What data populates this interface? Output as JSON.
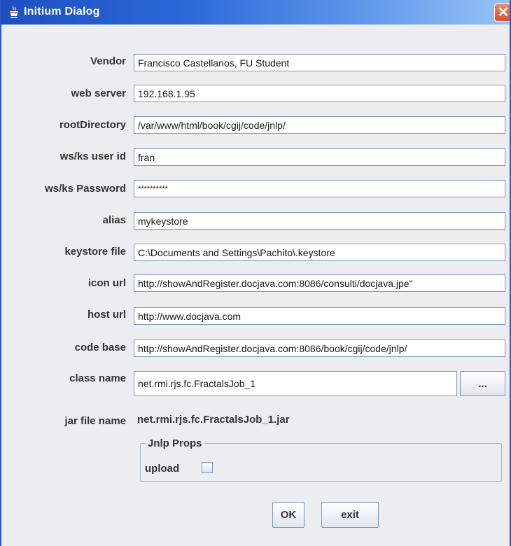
{
  "window": {
    "title": "Initium Dialog",
    "close_symbol": "✕"
  },
  "fields": [
    {
      "label": "Vendor",
      "value": "Francisco Castellanos, FU Student"
    },
    {
      "label": "web server",
      "value": "192.168.1.95"
    },
    {
      "label": "rootDirectory",
      "value": "/var/www/html/book/cgij/code/jnlp/"
    },
    {
      "label": "ws/ks user id",
      "value": "fran"
    },
    {
      "label": "ws/ks Password",
      "value": "**********"
    },
    {
      "label": "alias",
      "value": "mykeystore"
    },
    {
      "label": "keystore file",
      "value": "C:\\Documents and Settings\\Pachito\\.keystore"
    },
    {
      "label": "icon url",
      "value": "http://showAndRegister.docjava.com:8086/consulti/docjava.jpe\""
    },
    {
      "label": "host url",
      "value": "http://www.docjava.com"
    },
    {
      "label": "code base",
      "value": "http://showAndRegister.docjava.com:8086/book/cgij/code/jnlp/"
    },
    {
      "label": "class name",
      "value": "net.rmi.rjs.fc.FractalsJob_1"
    }
  ],
  "browse_button_label": "...",
  "jar": {
    "label": "jar file name",
    "value": "net.rmi.rjs.fc.FractalsJob_1.jar"
  },
  "jnlp_props": {
    "title": "Jnlp Props",
    "upload_label": "upload",
    "upload_checked": false
  },
  "buttons": {
    "ok": "OK",
    "exit": "exit"
  },
  "icons": {
    "title_icon": "java-cup-icon"
  }
}
